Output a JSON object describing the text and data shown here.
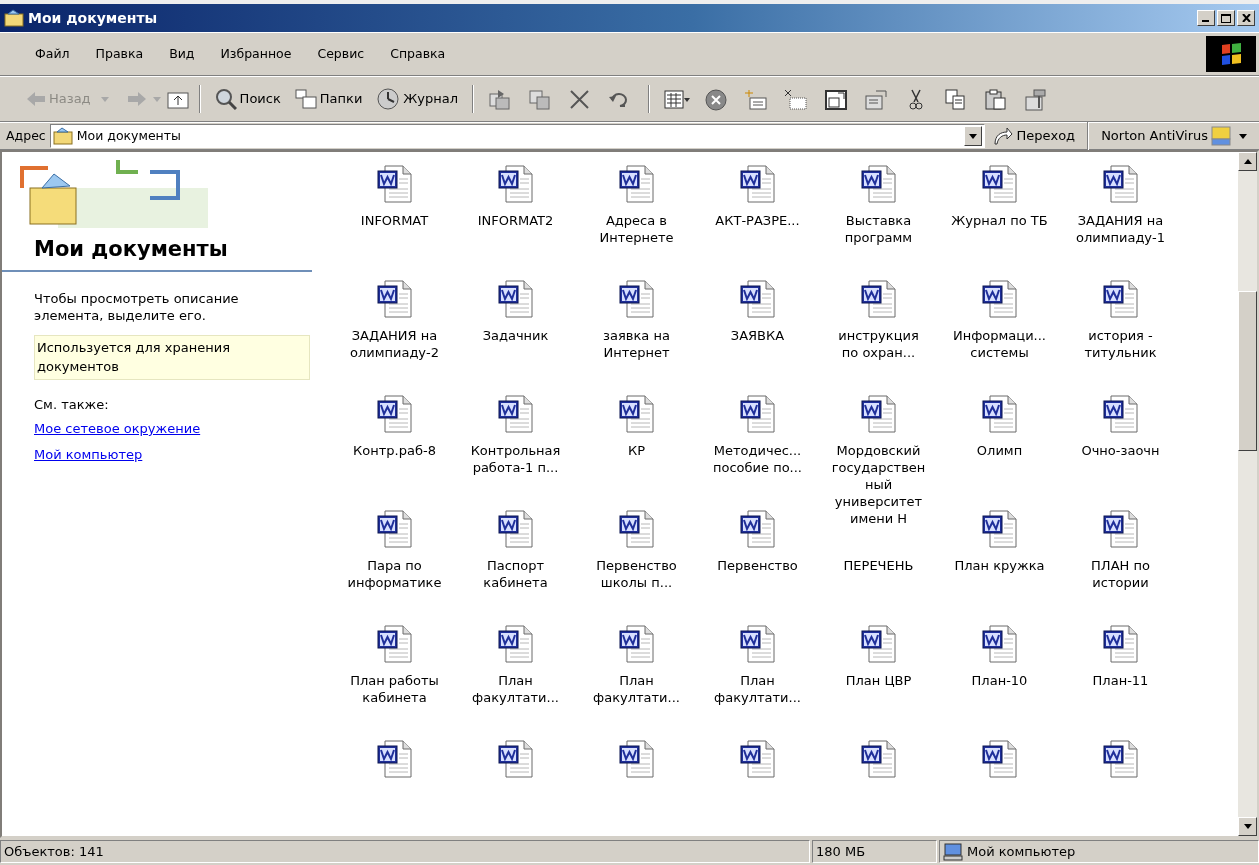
{
  "window": {
    "title": "Мои документы"
  },
  "menu": [
    "Файл",
    "Правка",
    "Вид",
    "Избранное",
    "Сервис",
    "Справка"
  ],
  "toolbar": [
    {
      "label": "Назад",
      "disabled": true
    },
    {
      "label": "Поиск",
      "disabled": false
    },
    {
      "label": "Папки",
      "disabled": false
    },
    {
      "label": "Журнал",
      "disabled": false
    }
  ],
  "address_bar": {
    "label": "Адрес",
    "value": "Мои документы",
    "go_button": "Переход",
    "addon": "Norton AntiVirus"
  },
  "task_pane": {
    "title": "Мои документы",
    "hint": "Чтобы просмотреть описание элемента, выделите его.",
    "info": "Используется для хранения документов",
    "see_also": "См. также:",
    "links": [
      "Мое сетевое окружение",
      "Мой компьютер"
    ]
  },
  "files": [
    {
      "label": "INFORMAT",
      "icon_visible": true
    },
    {
      "label": "INFORMAT2",
      "icon_visible": true
    },
    {
      "label": "Адреса в\nИнтернете",
      "icon_visible": true
    },
    {
      "label": "АКТ-РАЗРЕ...",
      "icon_visible": true
    },
    {
      "label": "Выставка\nпрограмм",
      "icon_visible": true
    },
    {
      "label": "Журнал по ТБ",
      "icon_visible": true
    },
    {
      "label": "ЗАДАНИЯ на\nолимпиаду-1",
      "icon_visible": true
    },
    {
      "label": "ЗАДАНИЯ на\nолимпиаду-2",
      "icon_visible": true
    },
    {
      "label": "Задачник",
      "icon_visible": true
    },
    {
      "label": "заявка на\nИнтернет",
      "icon_visible": true
    },
    {
      "label": "ЗАЯВКА",
      "icon_visible": true
    },
    {
      "label": "инструкция\nпо охран...",
      "icon_visible": true
    },
    {
      "label": "Информаци...\nсистемы",
      "icon_visible": true
    },
    {
      "label": "история -\nтитульник",
      "icon_visible": true
    },
    {
      "label": "Контр.раб-8",
      "icon_visible": true
    },
    {
      "label": "Контрольная\nработа-1 п...",
      "icon_visible": true
    },
    {
      "label": "КР",
      "icon_visible": true
    },
    {
      "label": "Методичес...\nпособие по...",
      "icon_visible": true
    },
    {
      "label": "Мордовский\nгосударствен\nный\nуниверситет\nимени Н",
      "icon_visible": true
    },
    {
      "label": "Олимп",
      "icon_visible": true
    },
    {
      "label": "Очно-заочн",
      "icon_visible": true
    },
    {
      "label": "Пара по\nинформатике",
      "icon_visible": true
    },
    {
      "label": "Паспорт\nкабинета",
      "icon_visible": true
    },
    {
      "label": "Первенство\nшколы п...",
      "icon_visible": true
    },
    {
      "label": "Первенство",
      "icon_visible": true
    },
    {
      "label": "ПЕРЕЧЕНЬ",
      "icon_visible": false
    },
    {
      "label": "План кружка",
      "icon_visible": true
    },
    {
      "label": "ПЛАН по\nистории",
      "icon_visible": true
    },
    {
      "label": "План работы\nкабинета",
      "icon_visible": true
    },
    {
      "label": "План\nфакултати...",
      "icon_visible": true
    },
    {
      "label": "План\nфакултати...",
      "icon_visible": true
    },
    {
      "label": "План\nфакултати...",
      "icon_visible": true
    },
    {
      "label": "План ЦВР",
      "icon_visible": true
    },
    {
      "label": "План-10",
      "icon_visible": true
    },
    {
      "label": "План-11",
      "icon_visible": true
    },
    {
      "icon_visible": true
    },
    {
      "icon_visible": true
    },
    {
      "icon_visible": true
    },
    {
      "icon_visible": true
    },
    {
      "icon_visible": true
    },
    {
      "icon_visible": true
    },
    {
      "icon_visible": true
    }
  ],
  "status_bar": {
    "objects": "Объектов: 141",
    "size": "180 МБ",
    "location": "Мой компьютер"
  }
}
